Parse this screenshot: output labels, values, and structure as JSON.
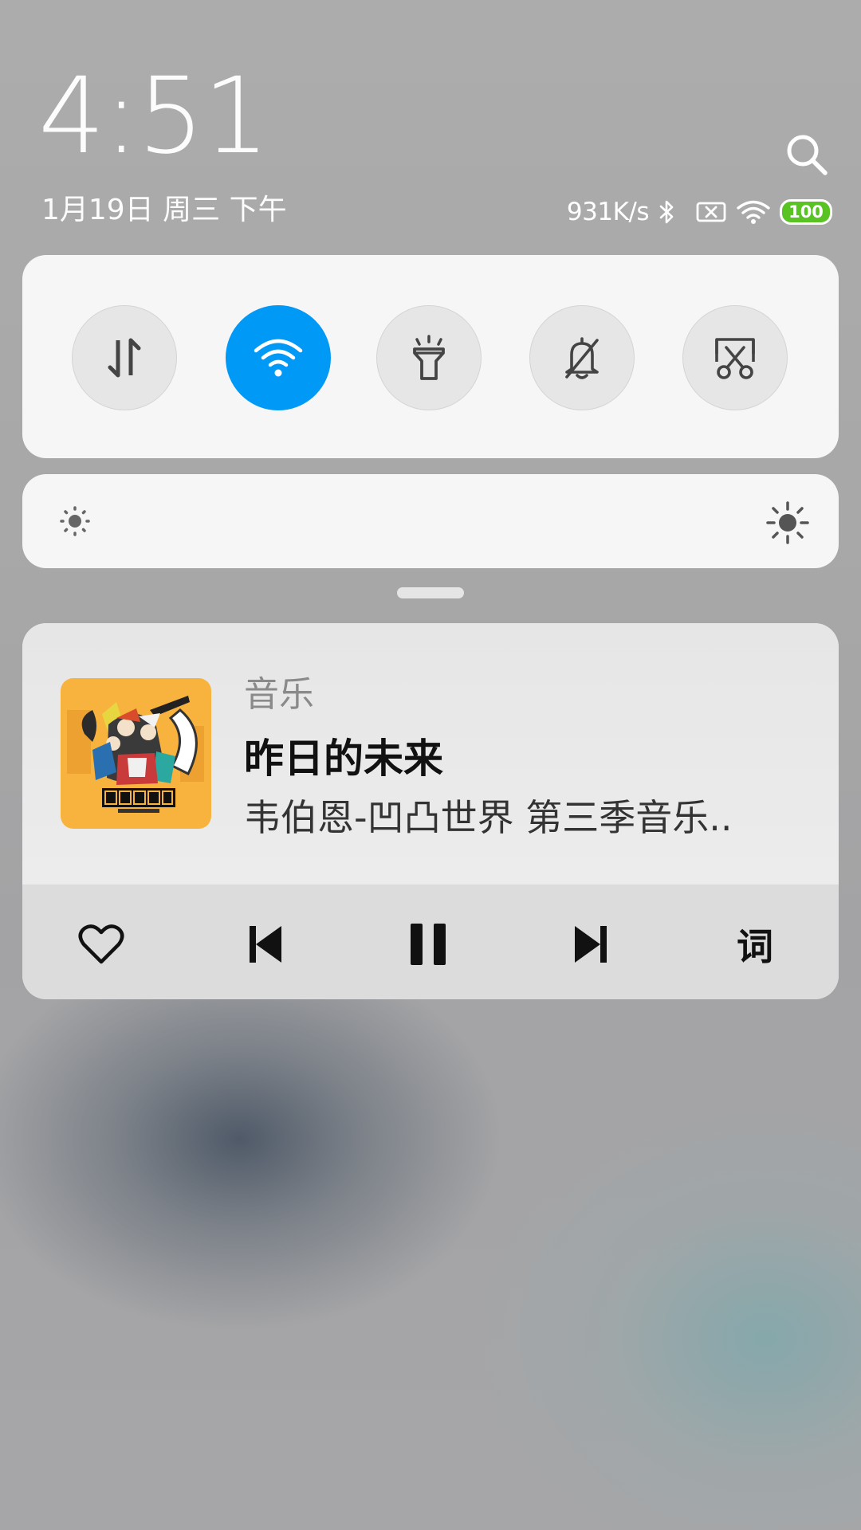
{
  "header": {
    "time": "4:51",
    "date": "1月19日 周三 下午",
    "search_icon": "search-icon"
  },
  "status": {
    "net_speed": "931K/s",
    "battery_level": "100",
    "battery_color": "#58c322",
    "icons": [
      "bluetooth-icon",
      "no-sim-icon",
      "wifi-signal-icon",
      "battery-icon"
    ]
  },
  "quick_toggles": [
    {
      "name": "mobile-data",
      "icon": "data-transfer-icon",
      "active": false
    },
    {
      "name": "wifi",
      "icon": "wifi-icon",
      "active": true
    },
    {
      "name": "flashlight",
      "icon": "flashlight-icon",
      "active": false
    },
    {
      "name": "mute",
      "icon": "bell-off-icon",
      "active": false
    },
    {
      "name": "screenshot",
      "icon": "screenshot-scissors-icon",
      "active": false
    }
  ],
  "accent_color": "#0099f5",
  "brightness": {
    "min_icon": "brightness-low-icon",
    "max_icon": "brightness-high-icon"
  },
  "music": {
    "app_name": "音乐",
    "title": "昨日的未来",
    "artist": "韦伯恩-凹凸世界 第三季音乐..",
    "controls": {
      "like_icon": "heart-icon",
      "prev_icon": "skip-previous-icon",
      "play_pause_icon": "pause-icon",
      "next_icon": "skip-next-icon",
      "lyrics_label": "词"
    }
  }
}
